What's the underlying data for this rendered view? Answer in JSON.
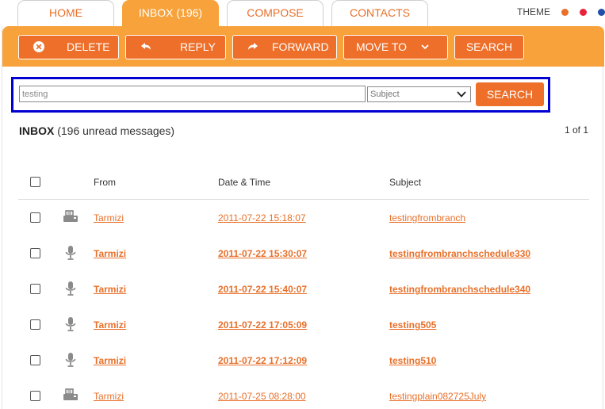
{
  "tabs": [
    {
      "label": "HOME",
      "active": false
    },
    {
      "label": "INBOX (196)",
      "active": true
    },
    {
      "label": "COMPOSE",
      "active": false
    },
    {
      "label": "CONTACTS",
      "active": false
    }
  ],
  "theme": {
    "label": "THEME",
    "dots": [
      "#e8702a",
      "#e8243c",
      "#1f4fa8"
    ]
  },
  "toolbar": {
    "delete": "DELETE",
    "reply": "REPLY",
    "forward": "FORWARD",
    "move_to": "MOVE TO",
    "search": "SEARCH"
  },
  "search": {
    "value": "testing",
    "field_selected": "Subject",
    "button": "SEARCH"
  },
  "inbox": {
    "title": "INBOX",
    "unread": "(196 unread messages)",
    "pager": "1 of 1"
  },
  "columns": {
    "from": "From",
    "date": "Date & Time",
    "subject": "Subject"
  },
  "messages": [
    {
      "icon": "fax-icon",
      "from": "Tarmizi",
      "date": "2011-07-22 15:18:07",
      "subject": "testingfrombranch",
      "unread": false
    },
    {
      "icon": "microphone-icon",
      "from": "Tarmizi",
      "date": "2011-07-22 15:30:07",
      "subject": "testingfrombranchschedule330",
      "unread": true
    },
    {
      "icon": "microphone-icon",
      "from": "Tarmizi",
      "date": "2011-07-22 15:40:07",
      "subject": "testingfrombranchschedule340",
      "unread": true
    },
    {
      "icon": "microphone-icon",
      "from": "Tarmizi",
      "date": "2011-07-22 17:05:09",
      "subject": "testing505",
      "unread": true
    },
    {
      "icon": "microphone-icon",
      "from": "Tarmizi",
      "date": "2011-07-22 17:12:09",
      "subject": "testing510",
      "unread": true
    },
    {
      "icon": "fax-icon",
      "from": "Tarmizi",
      "date": "2011-07-25 08:28:00",
      "subject": "testingplain082725July",
      "unread": false
    }
  ],
  "colors": {
    "accent": "#ee6f2a",
    "toolbar": "#f7a23a",
    "highlight_border": "#0000d0"
  }
}
